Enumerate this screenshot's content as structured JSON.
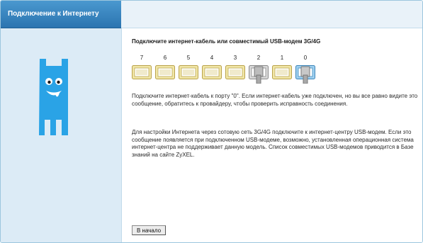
{
  "sidebar": {
    "tab_label": "Подключение к Интернету"
  },
  "main": {
    "title": "Подключите интернет-кабель или совместимый USB-модем 3G/4G",
    "ports": [
      {
        "label": "7",
        "state": "empty"
      },
      {
        "label": "6",
        "state": "empty"
      },
      {
        "label": "5",
        "state": "empty"
      },
      {
        "label": "4",
        "state": "empty"
      },
      {
        "label": "3",
        "state": "empty"
      },
      {
        "label": "2",
        "state": "connected"
      },
      {
        "label": "1",
        "state": "empty"
      },
      {
        "label": "0",
        "state": "connected-wan"
      }
    ],
    "paragraph1": "Подключите интернет-кабель к порту \"0\". Если интернет-кабель уже подключен, но вы все равно видите это сообщение, обратитесь к провайдеру, чтобы проверить исправность соединения.",
    "paragraph2": "Для настройки Интернета через сотовую сеть 3G/4G подключите к интернет-центру USB-модем. Если это сообщение появляется при подключенном USB-модеме, возможно, установленная операционная система интернет-центра не поддерживает данную модель. Список совместимых USB-модемов приводится в Базе знаний на сайте ZyXEL.",
    "home_button": "В начало"
  },
  "colors": {
    "tab_blue": "#2f7fbd",
    "sidebar_bg": "#dcebf6",
    "mascot": "#2aa3e6",
    "port_empty": "#f1e6a6",
    "port_connected": "#d9d9d9",
    "port_wan": "#9fd0f0"
  }
}
